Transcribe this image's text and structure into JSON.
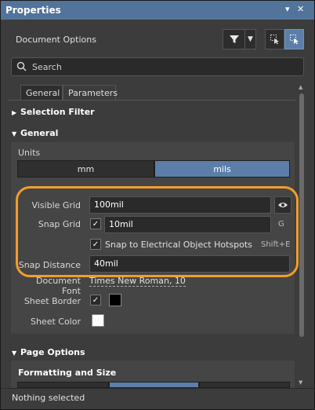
{
  "window": {
    "title": "Properties",
    "pin_icon": "pin-icon",
    "close_icon": "close-icon"
  },
  "header": {
    "document_options": "Document Options",
    "filter_icon": "filter-icon",
    "select_icon": "select-icon"
  },
  "search": {
    "placeholder": "Search"
  },
  "tabs": [
    {
      "label": "General",
      "active": true
    },
    {
      "label": "Parameters",
      "active": false
    }
  ],
  "sections": {
    "selection_filter": "Selection Filter",
    "general": "General",
    "page_options": "Page Options",
    "formatting_and_size": "Formatting and Size"
  },
  "units": {
    "label": "Units",
    "options": [
      "mm",
      "mils"
    ],
    "selected": "mils"
  },
  "grid": {
    "visible_grid_label": "Visible Grid",
    "visible_grid_value": "100mil",
    "snap_grid_label": "Snap Grid",
    "snap_grid_value": "10mil",
    "snap_grid_shortcut": "G",
    "snap_hotspots_label": "Snap to Electrical Object Hotspots",
    "snap_hotspots_shortcut": "Shift+E",
    "snap_distance_label": "Snap Distance",
    "snap_distance_value": "40mil"
  },
  "document": {
    "font_label": "Document Font",
    "font_value": "Times New Roman, 10",
    "sheet_border_label": "Sheet Border",
    "sheet_border_color": "#000000",
    "sheet_color_label": "Sheet Color",
    "sheet_color": "#ffffff"
  },
  "status": {
    "text": "Nothing selected"
  },
  "colors": {
    "accent": "#5b7fa8",
    "highlight": "#f39c2b"
  }
}
